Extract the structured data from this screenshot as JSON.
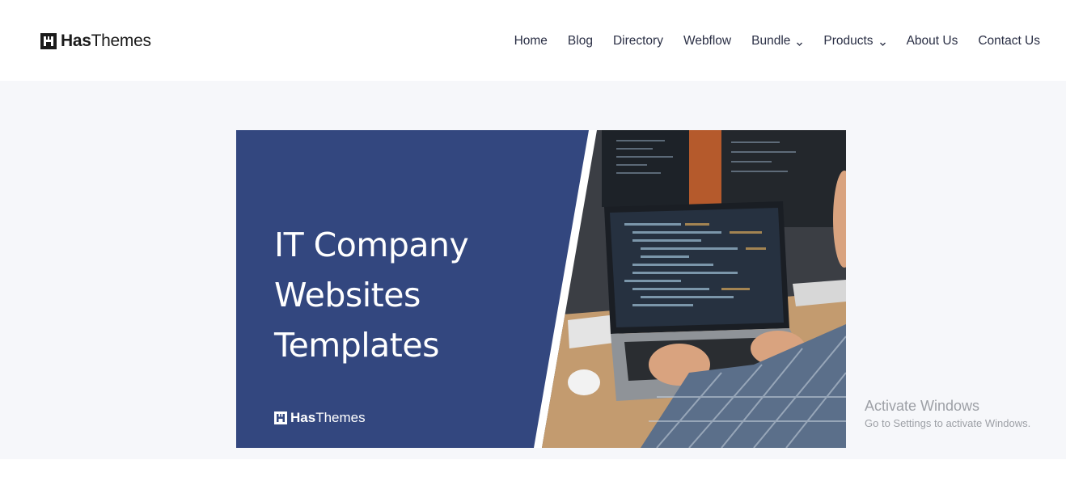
{
  "header": {
    "logo": {
      "bold": "Has",
      "light": "Themes"
    },
    "nav": [
      {
        "label": "Home",
        "dropdown": false
      },
      {
        "label": "Blog",
        "dropdown": false
      },
      {
        "label": "Directory",
        "dropdown": false
      },
      {
        "label": "Webflow",
        "dropdown": false
      },
      {
        "label": "Bundle",
        "dropdown": true
      },
      {
        "label": "Products",
        "dropdown": true
      },
      {
        "label": "About Us",
        "dropdown": false
      },
      {
        "label": "Contact Us",
        "dropdown": false
      }
    ]
  },
  "banner": {
    "title_lines": [
      "IT Company",
      "Websites",
      "Templates"
    ],
    "logo": {
      "bold": "Has",
      "light": "Themes"
    },
    "background": "#33477f",
    "photo_icon": "developer-laptop-photo"
  },
  "watermark": {
    "title": "Activate Windows",
    "subtitle": "Go to Settings to activate Windows."
  },
  "colors": {
    "nav_text": "#2a2f45",
    "hero_background": "#f6f7fa",
    "brand_dark": "#1b1b1b"
  }
}
